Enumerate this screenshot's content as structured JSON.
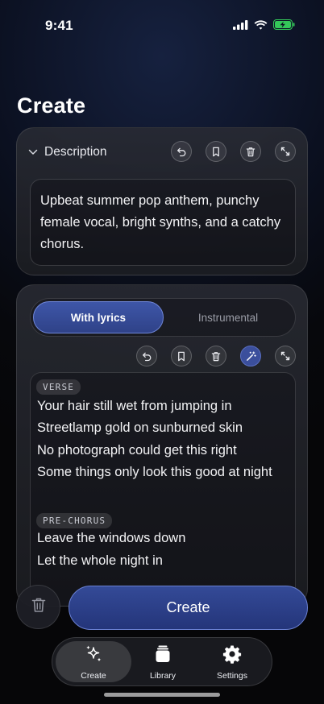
{
  "status_bar": {
    "time": "9:41"
  },
  "page": {
    "title": "Create"
  },
  "description_card": {
    "title": "Description",
    "text": "Upbeat summer pop anthem, punchy female vocal, bright synths, and a catchy chorus.",
    "icons": [
      "undo-icon",
      "bookmark-icon",
      "trash-icon",
      "expand-icon"
    ]
  },
  "lyrics_card": {
    "tabs": [
      {
        "label": "With lyrics",
        "selected": true
      },
      {
        "label": "Instrumental",
        "selected": false
      }
    ],
    "icons": [
      "undo-icon",
      "bookmark-icon",
      "trash-icon",
      "magic-wand-icon",
      "expand-icon"
    ],
    "sections": [
      {
        "tag": "VERSE",
        "lines": [
          "Your hair still wet from jumping in",
          "Streetlamp gold on sunburned skin",
          "No photograph could get this right",
          "Some things only look this good at night"
        ]
      },
      {
        "tag": "PRE-CHORUS",
        "lines": [
          "Leave the windows down",
          "Let the whole night in"
        ]
      }
    ]
  },
  "actions": {
    "create_label": "Create"
  },
  "tabbar": {
    "items": [
      {
        "label": "Create",
        "icon": "sparkles-icon",
        "active": true
      },
      {
        "label": "Library",
        "icon": "library-icon",
        "active": false
      },
      {
        "label": "Settings",
        "icon": "gear-icon",
        "active": false
      }
    ]
  },
  "colors": {
    "accent": "#3e56a8",
    "accent_border": "#6f86d8",
    "background": "#07080c"
  }
}
